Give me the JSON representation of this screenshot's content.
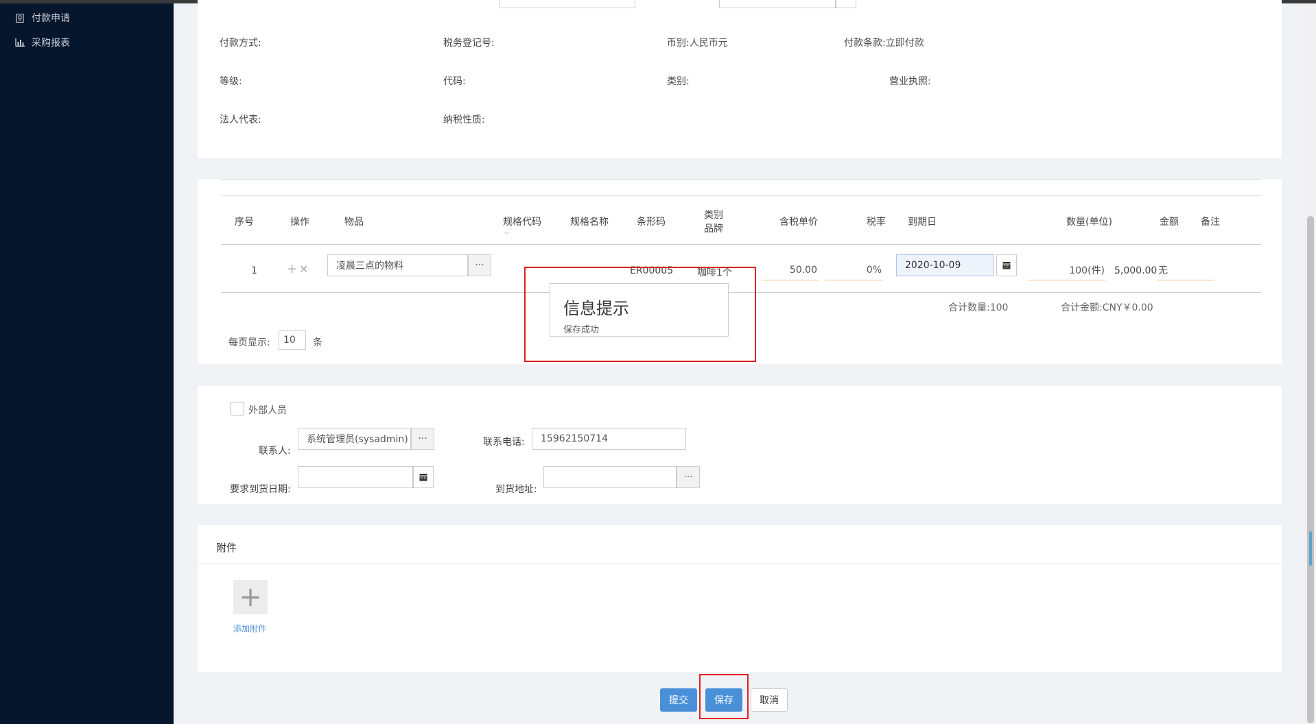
{
  "sidebar": {
    "items": [
      {
        "label": "付款申请",
        "icon": "document-icon"
      },
      {
        "label": "采购报表",
        "icon": "bar-chart-icon"
      }
    ]
  },
  "vendor_info": {
    "payment_method_label": "付款方式:",
    "tax_reg_label": "税务登记号:",
    "currency_label": "币别:",
    "currency_value": "人民币元",
    "payment_terms_label": "付款条款:",
    "payment_terms_value": "立即付款",
    "grade_label": "等级:",
    "code_label": "代码:",
    "category_label": "类别:",
    "license_label": "营业执照:",
    "legal_rep_label": "法人代表:",
    "tax_nature_label": "纳税性质:"
  },
  "items_table": {
    "headers": {
      "seq": "序号",
      "op": "操作",
      "item": "物品",
      "spec_code": "规格代码",
      "spec_name": "规格名称",
      "barcode": "条形码",
      "cat_brand_1": "类别",
      "cat_brand_2": "品牌",
      "price": "含税单价",
      "tax": "税率",
      "due": "到期日",
      "qty": "数量(单位)",
      "amount": "金额",
      "note": "备注"
    },
    "rows": [
      {
        "seq": "1",
        "item": "凌晨三点的物料",
        "barcode": "ER00005",
        "cat_brand": "咖啡1个",
        "price": "50.00",
        "tax": "0%",
        "due": "2020-10-09",
        "qty": "100(件)",
        "amount": "5,000.00",
        "note": "无"
      }
    ],
    "total_qty_label": "合计数量:",
    "total_qty": "100",
    "total_amount_label": "合计金额:",
    "total_amount": "CNY￥0.00",
    "page_size_label": "每页显示:",
    "page_size": "10",
    "page_size_unit": "条"
  },
  "toast": {
    "title": "信息提示",
    "message": "保存成功"
  },
  "contact": {
    "external_label": "外部人员",
    "contact_label": "联系人:",
    "contact_value": "系统管理员(sysadmin)",
    "phone_label": "联系电话:",
    "phone_value": "15962150714",
    "delivery_date_label": "要求到货日期:",
    "delivery_date_value": "",
    "address_label": "到货地址:",
    "address_value": ""
  },
  "attachments": {
    "title": "附件",
    "add_label": "添加附件"
  },
  "actions": {
    "submit": "提交",
    "save": "保存",
    "cancel": "取消"
  },
  "colors": {
    "sidebar_bg": "#06162c",
    "primary": "#4a90d9",
    "highlight_red": "#e02020",
    "underline_orange": "#f0c27a"
  }
}
